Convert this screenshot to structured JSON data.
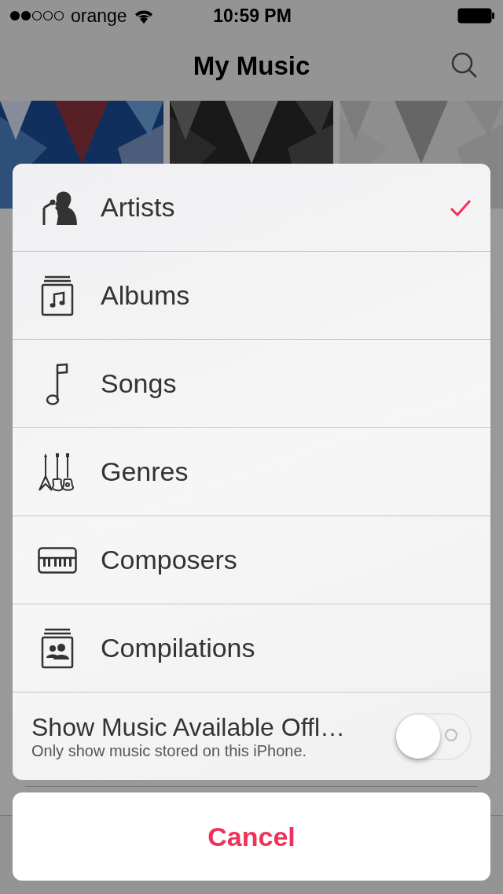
{
  "status_bar": {
    "carrier": "orange",
    "time": "10:59 PM"
  },
  "nav_bar": {
    "title": "My Music"
  },
  "action_sheet": {
    "items": [
      {
        "label": "Artists",
        "selected": true
      },
      {
        "label": "Albums",
        "selected": false
      },
      {
        "label": "Songs",
        "selected": false
      },
      {
        "label": "Genres",
        "selected": false
      },
      {
        "label": "Composers",
        "selected": false
      },
      {
        "label": "Compilations",
        "selected": false
      }
    ],
    "toggle": {
      "title": "Show Music Available Offl…",
      "subtitle": "Only show music stored on this iPhone.",
      "on": false
    },
    "cancel": "Cancel"
  }
}
